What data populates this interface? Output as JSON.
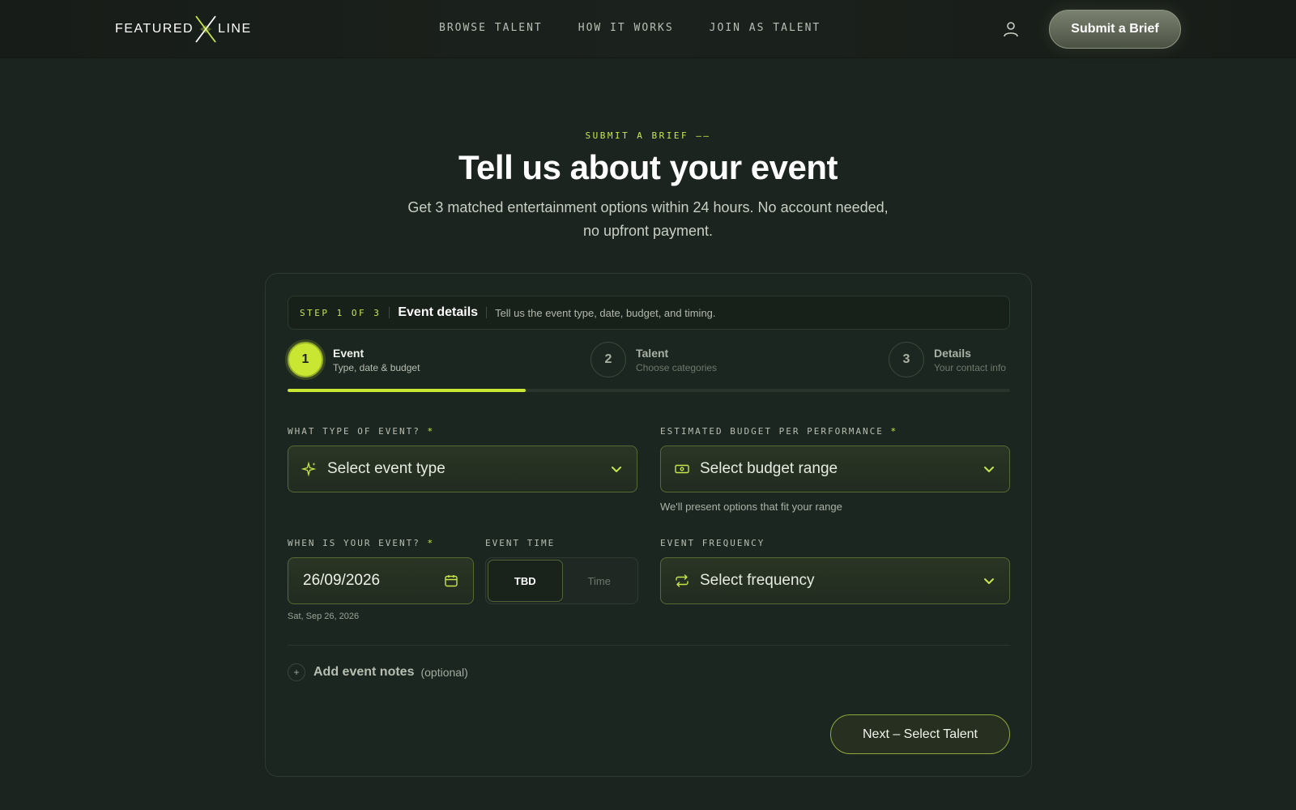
{
  "header": {
    "logo_left": "FEATURED",
    "logo_right": "LINE",
    "nav": [
      "BROWSE TALENT",
      "HOW IT WORKS",
      "JOIN AS TALENT"
    ],
    "cta_label": "Submit a Brief"
  },
  "hero": {
    "eyebrow": "SUBMIT A BRIEF ——",
    "title": "Tell us about your event",
    "subtitle": "Get 3 matched entertainment options within 24 hours. No account needed, no upfront payment."
  },
  "stepbar": {
    "count": "STEP 1 OF 3",
    "title": "Event details",
    "desc": "Tell us the event type, date, budget, and timing."
  },
  "steps": [
    {
      "num": "1",
      "name": "Event",
      "sub": "Type, date & budget",
      "active": true
    },
    {
      "num": "2",
      "name": "Talent",
      "sub": "Choose categories",
      "active": false
    },
    {
      "num": "3",
      "name": "Details",
      "sub": "Your contact info",
      "active": false
    }
  ],
  "progress": 0.33,
  "form": {
    "event_type": {
      "label": "WHAT TYPE OF EVENT?",
      "required": "*",
      "placeholder": "Select event type"
    },
    "budget": {
      "label": "ESTIMATED BUDGET PER PERFORMANCE",
      "required": "*",
      "placeholder": "Select budget range",
      "hint": "We'll present options that fit your range"
    },
    "date": {
      "label": "WHEN IS YOUR EVENT?",
      "required": "*",
      "value": "26/09/2026",
      "hint": "Sat, Sep 26, 2026"
    },
    "time": {
      "label": "EVENT TIME",
      "options": [
        "TBD",
        "Time"
      ],
      "selected": "TBD"
    },
    "frequency": {
      "label": "EVENT FREQUENCY",
      "placeholder": "Select frequency"
    },
    "notes": {
      "plus": "+",
      "label": "Add event notes",
      "optional": "(optional)"
    }
  },
  "next_button": "Next – Select Talent",
  "colors": {
    "accent": "#c9e633",
    "background": "#1b241e",
    "card": "#1c2620"
  }
}
